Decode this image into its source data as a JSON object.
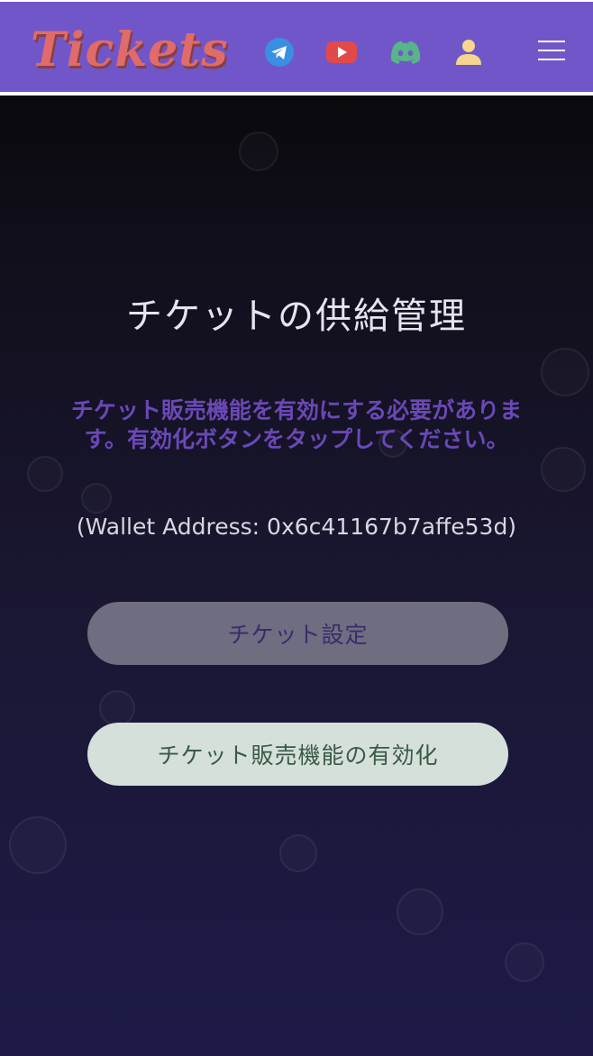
{
  "header": {
    "logo_text": "Tickets",
    "icons": [
      "telegram-icon",
      "youtube-icon",
      "discord-icon",
      "user-icon",
      "menu-icon"
    ]
  },
  "main": {
    "title": "チケットの供給管理",
    "notice": "チケット販売機能を有効にする必要があります。有効化ボタンをタップしてください。",
    "wallet": "(Wallet Address: 0x6c41167b7affe53d)",
    "settings_button": "チケット設定",
    "enable_button": "チケット販売機能の有効化"
  },
  "colors": {
    "header_bg": "#7156c9",
    "logo": "#e06b6b",
    "notice": "#6a48b6",
    "settings_button_bg": "#6f6d80",
    "enable_button_bg": "#d6e0da"
  }
}
